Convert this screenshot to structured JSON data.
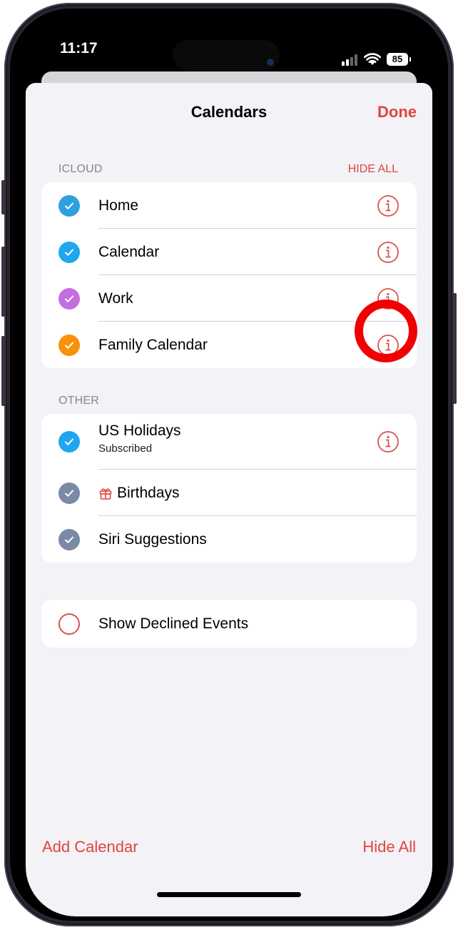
{
  "status_bar": {
    "time": "11:17",
    "battery_level": "85",
    "signal_icon": "cellular-signal-icon",
    "wifi_icon": "wifi-icon"
  },
  "nav": {
    "title": "Calendars",
    "done_label": "Done"
  },
  "sections": {
    "icloud": {
      "header": "ICLOUD",
      "action": "HIDE ALL",
      "items": [
        {
          "label": "Home",
          "color": "#2fa0df",
          "checked": true,
          "info_icon": "info-icon"
        },
        {
          "label": "Calendar",
          "color": "#1fa6ef",
          "checked": true,
          "info_icon": "info-icon"
        },
        {
          "label": "Work",
          "color": "#c36ee0",
          "checked": true,
          "info_icon": "info-icon"
        },
        {
          "label": "Family Calendar",
          "color": "#f7920d",
          "checked": true,
          "info_icon": "info-icon",
          "highlighted": true
        }
      ]
    },
    "other": {
      "header": "OTHER",
      "items": [
        {
          "label": "US Holidays",
          "sublabel": "Subscribed",
          "color": "#1fa6ef",
          "checked": true,
          "info_icon": "info-icon"
        },
        {
          "label": "Birthdays",
          "color": "#7b8aa4",
          "checked": true,
          "leading_icon": "gift-icon"
        },
        {
          "label": "Siri Suggestions",
          "color": "#7b8aa4",
          "checked": true
        }
      ]
    },
    "declined": {
      "label": "Show Declined Events",
      "checked": false
    }
  },
  "toolbar": {
    "add_calendar_label": "Add Calendar",
    "hide_all_label": "Hide All"
  },
  "colors": {
    "accent": "#e0453c",
    "highlight_ring": "#f00000",
    "background": "#f2f2f7"
  }
}
